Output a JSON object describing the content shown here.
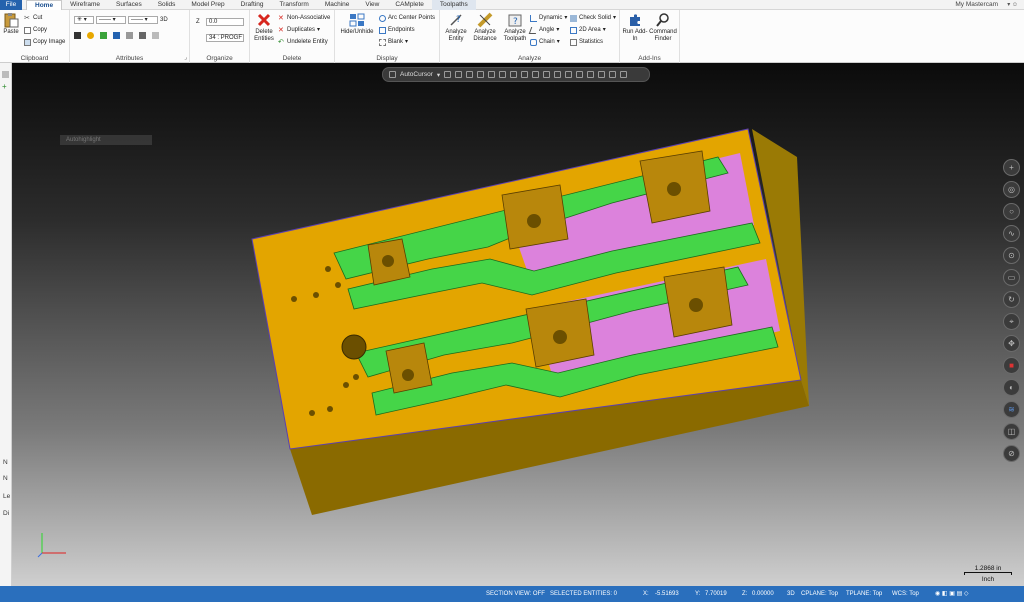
{
  "tabs": {
    "file": "File",
    "items": [
      "Home",
      "Wireframe",
      "Surfaces",
      "Solids",
      "Model Prep",
      "Drafting",
      "Transform",
      "Machine",
      "View",
      "CAMplete",
      "Toolpaths"
    ],
    "active": "Home"
  },
  "account": "My Mastercam",
  "ribbon": {
    "clipboard": {
      "label": "Clipboard",
      "paste": "Paste",
      "cut": "Cut",
      "copy": "Copy",
      "copy_image": "Copy Image"
    },
    "attributes": {
      "label": "Attributes",
      "mode3d": "3D"
    },
    "organize": {
      "label": "Organize",
      "z_label": "Z",
      "z_value": "0.0",
      "level_value": "34 : PROGF"
    },
    "delete": {
      "label": "Delete",
      "delete_entities": "Delete Entities",
      "non_associative": "Non-Associative",
      "duplicates": "Duplicates",
      "undelete": "Undelete Entity"
    },
    "display": {
      "label": "Display",
      "hide_unhide": "Hide/Unhide",
      "arc_center": "Arc Center Points",
      "endpoints": "Endpoints",
      "blank": "Blank"
    },
    "analyze": {
      "label": "Analyze",
      "analyze_entity": "Analyze Entity",
      "analyze_distance": "Analyze Distance",
      "analyze_toolpath": "Analyze Toolpath",
      "dynamic": "Dynamic",
      "angle": "Angle",
      "chain": "Chain",
      "check_solid": "Check Solid",
      "area_2d": "2D Area",
      "statistics": "Statistics"
    },
    "addins": {
      "label": "Add-Ins",
      "run_addin": "Run Add-In",
      "command_finder": "Command Finder"
    }
  },
  "left_strip": [
    "N",
    "N",
    "Le",
    "Di"
  ],
  "viewport": {
    "faint_label": "Autohighlight",
    "autocursor": "AutoCursor",
    "scale_value": "1.2868 in",
    "scale_unit": "Inch"
  },
  "status": {
    "section_view": "SECTION VIEW: OFF",
    "selected": "SELECTED ENTITIES: 0",
    "x_label": "X:",
    "x_value": "-5.51693",
    "y_label": "Y:",
    "y_value": "7.70019",
    "z_label": "Z:",
    "z_value": "0.00000",
    "mode": "3D",
    "cplane": "CPLANE: Top",
    "tplane": "TPLANE: Top",
    "wcs": "WCS: Top"
  },
  "colors": {
    "file_tab": "#2462ad",
    "status_bar": "#2a6fbd",
    "model_body": "#e3a500",
    "model_side": "#8a6a00",
    "green_parts": "#45d548",
    "pink_pockets": "#dc82dc",
    "brown_blocks": "#b8870c"
  },
  "icons": {
    "paste": "paste-icon",
    "cut": "scissors-icon",
    "copy": "copy-icon",
    "delete": "red-x-icon",
    "analyze": "ruler-icon",
    "run_addin": "puzzle-icon",
    "command_finder": "magnifier-icon"
  }
}
